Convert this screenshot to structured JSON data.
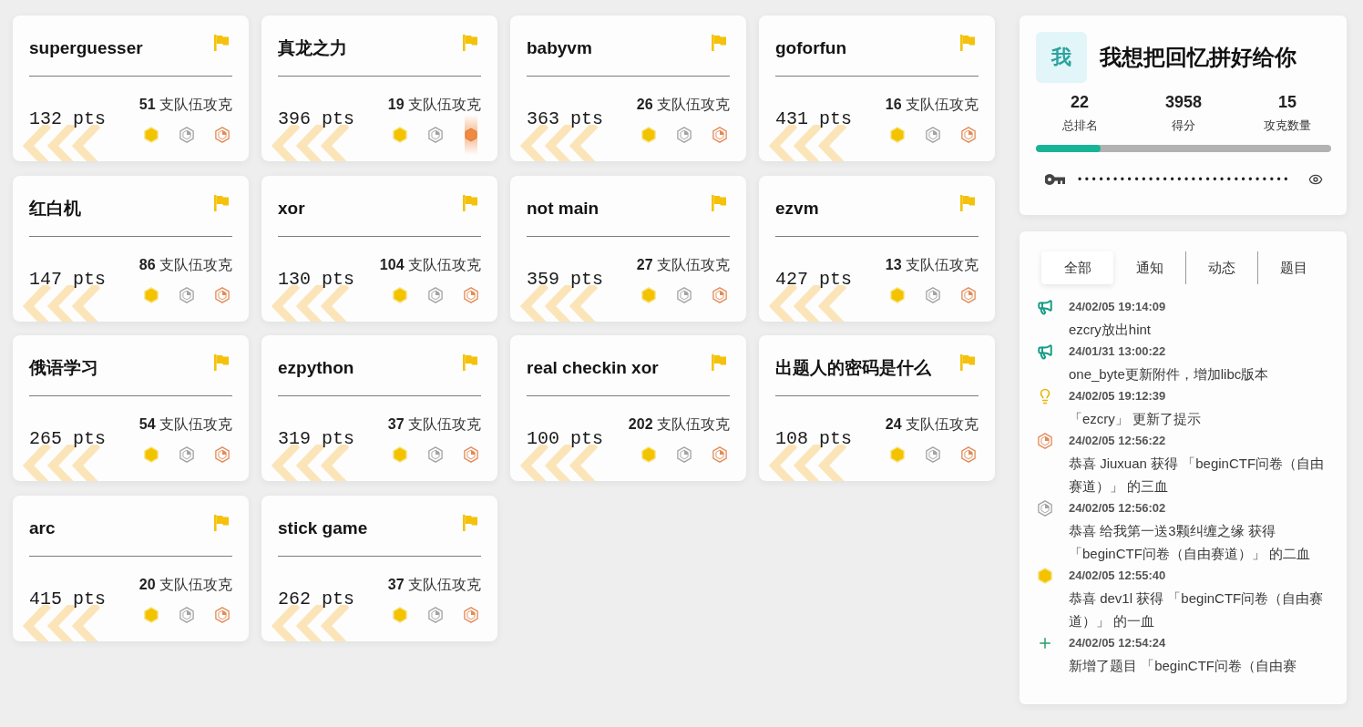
{
  "challenges": [
    {
      "title": "superguesser",
      "points": "132 pts",
      "solved_by": "**51** 支队伍攻克",
      "bronze_highlighted": false
    },
    {
      "title": "真龙之力",
      "points": "396 pts",
      "solved_by": "**19** 支队伍攻克",
      "bronze_highlighted": true
    },
    {
      "title": "babyvm",
      "points": "363 pts",
      "solved_by": "**26** 支队伍攻克",
      "bronze_highlighted": false
    },
    {
      "title": "goforfun",
      "points": "431 pts",
      "solved_by": "**16** 支队伍攻克",
      "bronze_highlighted": false
    },
    {
      "title": "红白机",
      "points": "147 pts",
      "solved_by": "**86** 支队伍攻克",
      "bronze_highlighted": false
    },
    {
      "title": "xor",
      "points": "130 pts",
      "solved_by": "**104** 支队伍攻克",
      "bronze_highlighted": false
    },
    {
      "title": "not main",
      "points": "359 pts",
      "solved_by": "**27** 支队伍攻克",
      "bronze_highlighted": false
    },
    {
      "title": "ezvm",
      "points": "427 pts",
      "solved_by": "**13** 支队伍攻克",
      "bronze_highlighted": false
    },
    {
      "title": "俄语学习",
      "points": "265 pts",
      "solved_by": "**54** 支队伍攻克",
      "bronze_highlighted": false
    },
    {
      "title": "ezpython",
      "points": "319 pts",
      "solved_by": "**37** 支队伍攻克",
      "bronze_highlighted": false
    },
    {
      "title": "real checkin xor",
      "points": "100 pts",
      "solved_by": "**202** 支队伍攻克",
      "bronze_highlighted": false
    },
    {
      "title": "出题人的密码是什么",
      "points": "108 pts",
      "solved_by": "**24** 支队伍攻克",
      "bronze_highlighted": false
    },
    {
      "title": "arc",
      "points": "415 pts",
      "solved_by": "**20** 支队伍攻克",
      "bronze_highlighted": false
    },
    {
      "title": "stick game",
      "points": "262 pts",
      "solved_by": "**37** 支队伍攻克",
      "bronze_highlighted": false
    }
  ],
  "user": {
    "avatar": "我",
    "name": "我想把回忆拼好给你",
    "stats": [
      {
        "value": "22",
        "label": "总排名"
      },
      {
        "value": "3958",
        "label": "得分"
      },
      {
        "value": "15",
        "label": "攻克数量"
      }
    ],
    "progress": {
      "level": 0.22
    },
    "token": {
      "value": "••••••••••••••••••••••••••••••"
    }
  },
  "feed": {
    "tabs": [
      {
        "label": "全部",
        "selected": true
      },
      {
        "label": "通知",
        "selected": false
      },
      {
        "label": "动态",
        "selected": false
      },
      {
        "label": "题目",
        "selected": false
      }
    ],
    "items": [
      {
        "kind": "announcement",
        "time": "24/02/05 19:14:09",
        "message": "ezcry放出hint"
      },
      {
        "kind": "announcement",
        "time": "24/01/31 13:00:22",
        "message": "one_byte更新附件，增加libc版本"
      },
      {
        "kind": "hint",
        "time": "24/02/05 19:12:39",
        "message": "「ezcry」 更新了提示"
      },
      {
        "kind": "third_blood",
        "time": "24/02/05 12:56:22",
        "message": "恭喜 Jiuxuan 获得 「beginCTF问卷（自由赛道）」 的三血"
      },
      {
        "kind": "second_blood",
        "time": "24/02/05 12:56:02",
        "message": "恭喜 给我第一送3颗纠缠之缘 获得「beginCTF问卷（自由赛道）」 的二血"
      },
      {
        "kind": "first_blood",
        "time": "24/02/05 12:55:40",
        "message": "恭喜 dev1l 获得 「beginCTF问卷（自由赛道）」 的一血"
      },
      {
        "kind": "new_challenge",
        "time": "24/02/05 12:54:24",
        "message": "新增了题目 「beginCTF问卷（自由赛"
      }
    ]
  }
}
